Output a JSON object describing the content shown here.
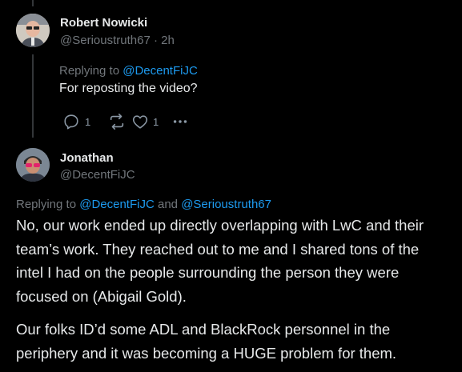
{
  "reply": {
    "author_name": "Robert Nowicki",
    "author_handle": "@Serioustruth67",
    "time_sep": " · ",
    "time": "2h",
    "replying_prefix": "Replying to ",
    "replying_to": "@DecentFiJC",
    "text": "For reposting the video?",
    "actions": {
      "reply_count": "1",
      "repost_count": "",
      "like_count": "1"
    }
  },
  "main": {
    "author_name": "Jonathan",
    "author_handle": "@DecentFiJC",
    "replying_prefix": "Replying to ",
    "replying_to_1": "@DecentFiJC",
    "replying_and": " and ",
    "replying_to_2": "@Serioustruth67",
    "paragraph_1": "No, our work ended up directly overlapping with LwC and their team’s work. They reached out to me and I shared tons of the intel I had on the people surrounding the person they were focused on (Abigail Gold).",
    "paragraph_2": "Our folks ID’d some ADL and BlackRock personnel in the periphery and it was becoming a HUGE problem for them."
  },
  "colors": {
    "background": "#000000",
    "text": "#e7e9ea",
    "secondary": "#71767b",
    "link": "#1d9bf0"
  },
  "icons": [
    "reply-icon",
    "repost-icon",
    "like-icon",
    "more-icon"
  ]
}
